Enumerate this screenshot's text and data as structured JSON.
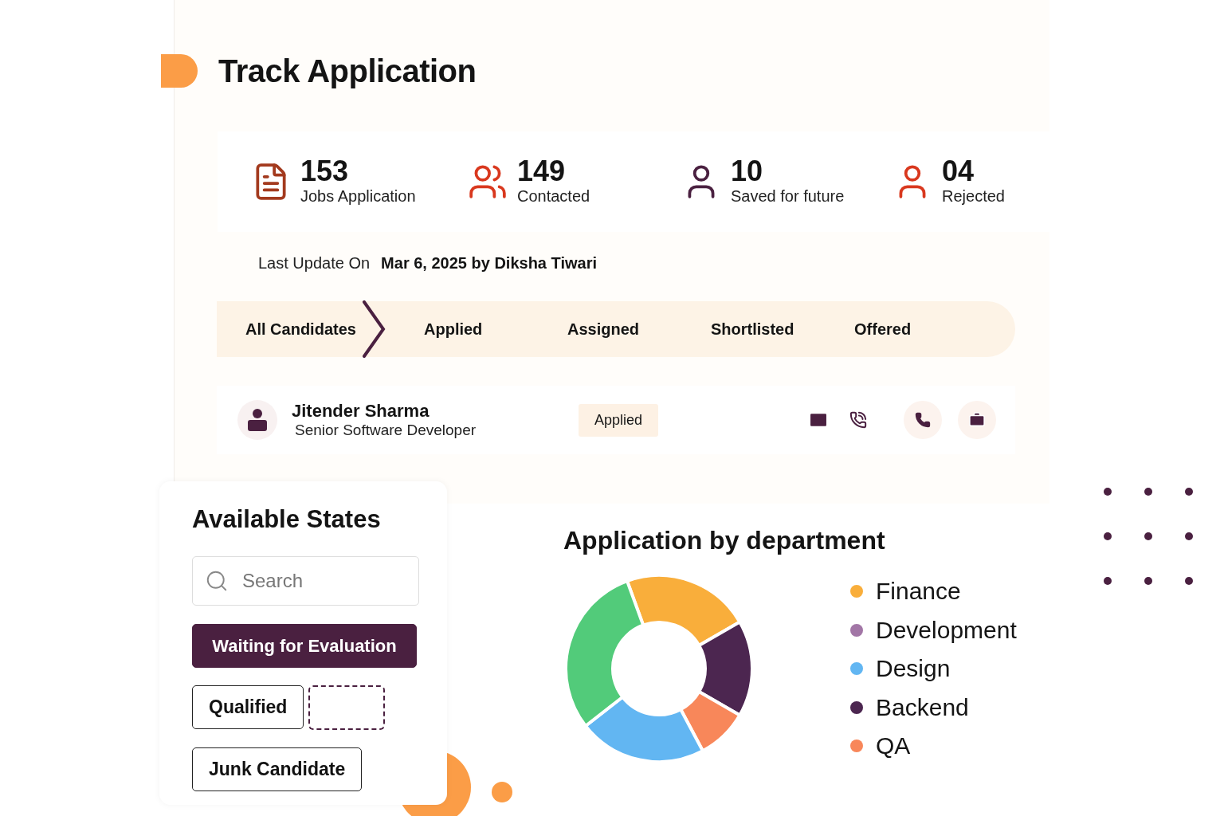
{
  "page": {
    "title": "Track Application"
  },
  "stats": [
    {
      "kind": "document",
      "value": "153",
      "label": "Jobs Application",
      "color": "#a33a1e"
    },
    {
      "kind": "group",
      "value": "149",
      "label": "Contacted",
      "color": "#d9381e"
    },
    {
      "kind": "person",
      "value": "10",
      "label": "Saved for future",
      "color": "#4a2040"
    },
    {
      "kind": "person",
      "value": "04",
      "label": "Rejected",
      "color": "#d9381e"
    }
  ],
  "last_update": {
    "label": "Last Update On",
    "value": "Mar 6, 2025 by **Diksha Tiwari**"
  },
  "stages": [
    {
      "label": "All Candidates",
      "selected": true
    },
    {
      "label": "Applied",
      "selected": false
    },
    {
      "label": "Assigned",
      "selected": false
    },
    {
      "label": "Shortlisted",
      "selected": false
    },
    {
      "label": "Offered",
      "selected": false
    }
  ],
  "candidate": {
    "name": "Jitender Sharma",
    "role": "Senior Software Developer",
    "status": "Applied"
  },
  "available_states": {
    "title": "Available States",
    "search": {
      "placeholder": "Search"
    },
    "states": [
      {
        "kind": "chip",
        "label": "Waiting for Evaluation",
        "selected": true
      },
      {
        "kind": "chip",
        "label": "Qualified",
        "selected": false
      },
      {
        "kind": "slot"
      },
      {
        "kind": "chip",
        "label": "Junk Candidate",
        "selected": false
      }
    ]
  },
  "department_chart": {
    "title": "Application by department",
    "legend": [
      {
        "label": "Finance",
        "color": "#f9ae3b"
      },
      {
        "label": "Development",
        "color": "#a276a6"
      },
      {
        "label": "Design",
        "color": "#62b6f2"
      },
      {
        "label": "Backend",
        "color": "#4c2650"
      },
      {
        "label": "QA",
        "color": "#f8875a"
      }
    ]
  }
}
